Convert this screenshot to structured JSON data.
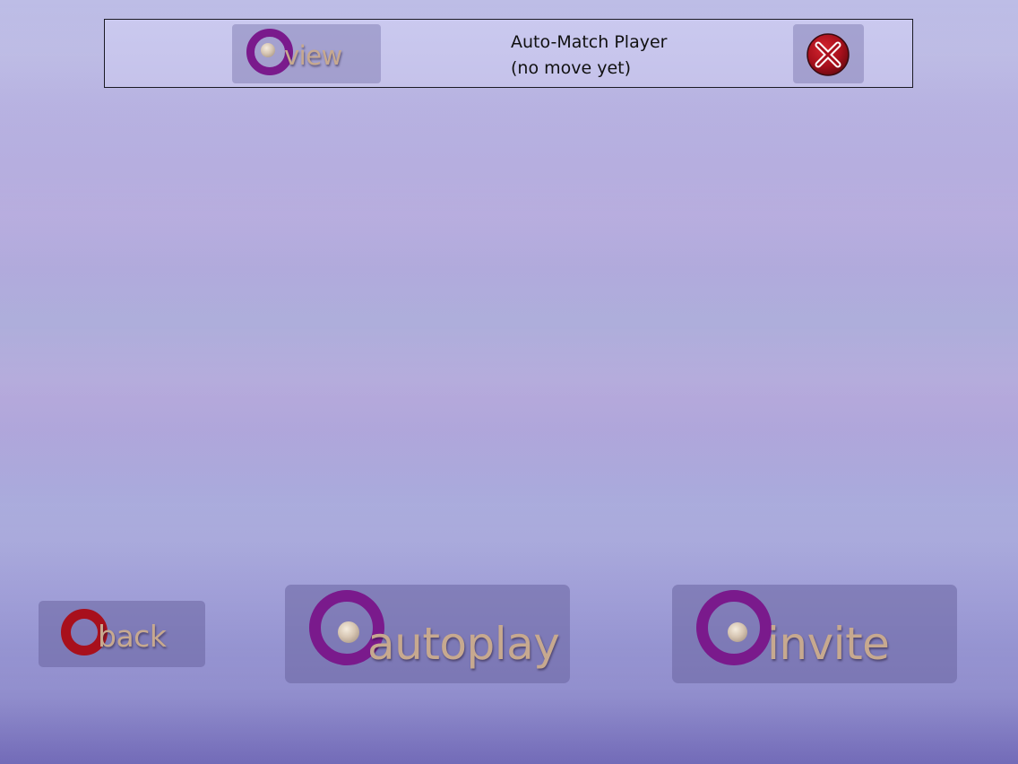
{
  "colors": {
    "ring_purple": "#7a1a8c",
    "ring_red": "#a8101c",
    "label_tan": "#c7a98f",
    "bar_border": "#1a1a24"
  },
  "game_bar": {
    "view_label": "view",
    "view_icon": "purple-ring-pearl-icon",
    "opponent_name": "Auto-Match Player",
    "opponent_status": "(no move yet)",
    "resign_icon": "red-x-circle-icon"
  },
  "bottom": {
    "back_label": "back",
    "back_icon": "red-ring-icon",
    "autoplay_label": "autoplay",
    "autoplay_icon": "purple-ring-pearl-icon",
    "invite_label": "invite",
    "invite_icon": "purple-ring-pearl-icon"
  }
}
